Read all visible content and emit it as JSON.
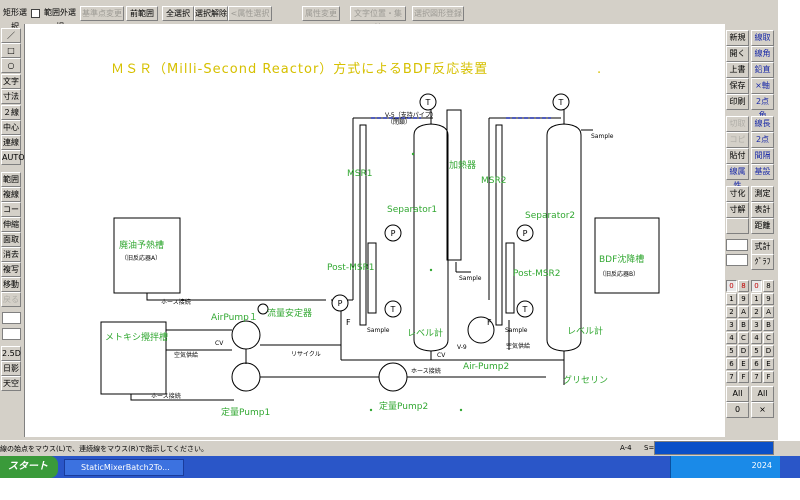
{
  "toolbar": {
    "select_label": "矩形選択",
    "outside_label": "範囲外選択",
    "base_change": "基準点変更",
    "prev_range": "前範囲",
    "select_all": "全選択",
    "deselect": "選択解除",
    "attr_select": "<属性選択>",
    "attr_change": "属性変更",
    "text_pos": "文字位置・集計",
    "register": "選択図形登録"
  },
  "left_tools": [
    "／",
    "□",
    "○",
    "文字",
    "寸法",
    "２線",
    "中心線",
    "連線",
    "AUTO",
    "範囲",
    "複線",
    "コーナー",
    "伸縮",
    "面取",
    "消去",
    "複写",
    "移動",
    "戻る",
    "2.5D",
    "日影",
    "天空"
  ],
  "right_tools": [
    [
      "新規",
      "線取"
    ],
    [
      "開く",
      "線角"
    ],
    [
      "上書",
      "鉛直"
    ],
    [
      "保存",
      "×軸"
    ],
    [
      "印刷",
      "2点角"
    ],
    [
      "切取",
      "線長"
    ],
    [
      "コピー",
      "2点長"
    ],
    [
      "貼付",
      "間隔"
    ],
    [
      "線属性",
      "基設"
    ],
    [
      "寸化",
      "測定"
    ],
    [
      "寸解",
      "表計"
    ],
    [
      "",
      "距離"
    ],
    [
      "",
      "式計"
    ],
    [
      "",
      "ｸﾞﾗﾌ"
    ]
  ],
  "layer_numbers": [
    "0",
    "8",
    "0",
    "8",
    "1",
    "9",
    "1",
    "9",
    "2",
    "A",
    "2",
    "A",
    "3",
    "B",
    "3",
    "B",
    "4",
    "C",
    "4",
    "C",
    "5",
    "D",
    "5",
    "D",
    "6",
    "E",
    "6",
    "E",
    "7",
    "F",
    "7",
    "F"
  ],
  "layer_bottom": [
    "All",
    "All",
    "0",
    "×"
  ],
  "diagram": {
    "title": "ＭＳＲ（Milli-Second Reactor）方式によるBDF反応装置",
    "v5": "V-5（支持パイプ）",
    "v5b": "（閉鎖）",
    "msr1": "MSR1",
    "msr2": "MSR2",
    "heater": "加熱器",
    "sep1": "Separator1",
    "sep2": "Separator2",
    "post1": "Post-MSR1",
    "post2": "Post-MSR2",
    "waste_tank": "廃油予熱槽",
    "waste_sub": "（旧反応器A）",
    "bdf_tank": "BDF沈降槽",
    "bdf_sub": "（旧反応器B）",
    "methoxy": "メトキシ攪拌槽",
    "hose1": "ホース接続",
    "hose2": "ホース接続",
    "hose3": "ホース接続",
    "airpump1": "AirPump１",
    "flowstab": "流量安定器",
    "cv1": "CV",
    "air_supply1": "空気供給",
    "recycle": "リサイクル",
    "level1": "レベル計",
    "level2": "レベル計",
    "airpump2": "Air-Pump2",
    "air_supply2": "空気供給",
    "v9": "V-9",
    "cv2": "CV",
    "metering1": "定量Pump1",
    "metering2": "定量Pump2",
    "glycerin": "グリセリン",
    "sample": "Sample",
    "F": "F",
    "P": "P",
    "T": "T"
  },
  "status": {
    "message": "線の始点をマウス(L)で、連続線をマウス(R)で指示してください。",
    "sheet": "A-4",
    "scale": "S="
  },
  "taskbar": {
    "start": "スタート",
    "task": "StaticMixerBatch2To...",
    "clock": "2024"
  },
  "colors": {
    "green": "#33a833",
    "title_yellow": "#d6c000"
  }
}
